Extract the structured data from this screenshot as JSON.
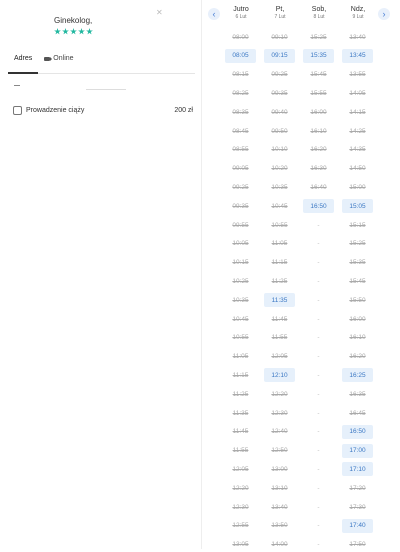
{
  "doctor": {
    "specialty": "Ginekolog,",
    "close_icon": "close-icon",
    "rating_stars": 5,
    "star_color": "#22b8a0"
  },
  "tabs": [
    {
      "label": "Adres",
      "active": true
    },
    {
      "label": "Online",
      "active": false,
      "icon": "video-icon"
    }
  ],
  "service": {
    "name": "Prowadzenie ciąży",
    "price": "200 zł",
    "icon": "clipboard-icon"
  },
  "calendar": {
    "days": [
      {
        "name": "Jutro",
        "date": "6 Lut"
      },
      {
        "name": "Pt,",
        "date": "7 Lut"
      },
      {
        "name": "Sob,",
        "date": "8 Lut"
      },
      {
        "name": "Ndz,",
        "date": "9 Lut"
      }
    ],
    "columns": [
      [
        [
          "08:00",
          "t"
        ],
        [
          "08:05",
          "f"
        ],
        [
          "08:15",
          "t"
        ],
        [
          "08:25",
          "t"
        ],
        [
          "08:35",
          "t"
        ],
        [
          "08:45",
          "t"
        ],
        [
          "08:55",
          "t"
        ],
        [
          "09:05",
          "t"
        ],
        [
          "09:25",
          "t"
        ],
        [
          "09:35",
          "t"
        ],
        [
          "09:55",
          "t"
        ],
        [
          "10:05",
          "t"
        ],
        [
          "10:15",
          "t"
        ],
        [
          "10:25",
          "t"
        ],
        [
          "10:35",
          "t"
        ],
        [
          "10:45",
          "t"
        ],
        [
          "10:55",
          "t"
        ],
        [
          "11:05",
          "t"
        ],
        [
          "11:15",
          "t"
        ],
        [
          "11:25",
          "t"
        ],
        [
          "11:35",
          "t"
        ],
        [
          "11:45",
          "t"
        ],
        [
          "11:55",
          "t"
        ],
        [
          "12:05",
          "t"
        ],
        [
          "12:20",
          "t"
        ],
        [
          "12:30",
          "t"
        ],
        [
          "12:55",
          "t"
        ],
        [
          "13:05",
          "t"
        ]
      ],
      [
        [
          "09:10",
          "t"
        ],
        [
          "09:15",
          "f"
        ],
        [
          "09:25",
          "t"
        ],
        [
          "09:35",
          "t"
        ],
        [
          "09:40",
          "t"
        ],
        [
          "09:50",
          "t"
        ],
        [
          "10:10",
          "t"
        ],
        [
          "10:20",
          "t"
        ],
        [
          "10:35",
          "t"
        ],
        [
          "10:45",
          "t"
        ],
        [
          "10:55",
          "t"
        ],
        [
          "11:05",
          "t"
        ],
        [
          "11:15",
          "t"
        ],
        [
          "11:25",
          "t"
        ],
        [
          "11:35",
          "f"
        ],
        [
          "11:45",
          "t"
        ],
        [
          "11:55",
          "t"
        ],
        [
          "12:05",
          "t"
        ],
        [
          "12:10",
          "f"
        ],
        [
          "12:20",
          "t"
        ],
        [
          "12:30",
          "t"
        ],
        [
          "12:40",
          "t"
        ],
        [
          "12:50",
          "t"
        ],
        [
          "13:00",
          "t"
        ],
        [
          "13:10",
          "t"
        ],
        [
          "13:40",
          "t"
        ],
        [
          "13:50",
          "t"
        ],
        [
          "14:00",
          "t"
        ]
      ],
      [
        [
          "15:25",
          "t"
        ],
        [
          "15:35",
          "f"
        ],
        [
          "15:45",
          "t"
        ],
        [
          "15:55",
          "t"
        ],
        [
          "16:00",
          "t"
        ],
        [
          "16:10",
          "t"
        ],
        [
          "16:20",
          "t"
        ],
        [
          "16:30",
          "t"
        ],
        [
          "16:40",
          "t"
        ],
        [
          "16:50",
          "f"
        ],
        [
          "-",
          "n"
        ],
        [
          "-",
          "n"
        ],
        [
          "-",
          "n"
        ],
        [
          "-",
          "n"
        ],
        [
          "-",
          "n"
        ],
        [
          "-",
          "n"
        ],
        [
          "-",
          "n"
        ],
        [
          "-",
          "n"
        ],
        [
          "-",
          "n"
        ],
        [
          "-",
          "n"
        ],
        [
          "-",
          "n"
        ],
        [
          "-",
          "n"
        ],
        [
          "-",
          "n"
        ],
        [
          "-",
          "n"
        ],
        [
          "-",
          "n"
        ],
        [
          "-",
          "n"
        ],
        [
          "-",
          "n"
        ],
        [
          "-",
          "n"
        ]
      ],
      [
        [
          "13:40",
          "t"
        ],
        [
          "13:45",
          "f"
        ],
        [
          "13:55",
          "t"
        ],
        [
          "14:05",
          "t"
        ],
        [
          "14:15",
          "t"
        ],
        [
          "14:25",
          "t"
        ],
        [
          "14:35",
          "t"
        ],
        [
          "14:50",
          "t"
        ],
        [
          "15:00",
          "t"
        ],
        [
          "15:05",
          "f"
        ],
        [
          "15:15",
          "t"
        ],
        [
          "15:25",
          "t"
        ],
        [
          "15:35",
          "t"
        ],
        [
          "15:45",
          "t"
        ],
        [
          "15:50",
          "t"
        ],
        [
          "16:00",
          "t"
        ],
        [
          "16:10",
          "t"
        ],
        [
          "16:20",
          "t"
        ],
        [
          "16:25",
          "f"
        ],
        [
          "16:35",
          "t"
        ],
        [
          "16:45",
          "t"
        ],
        [
          "16:50",
          "f"
        ],
        [
          "17:00",
          "f"
        ],
        [
          "17:10",
          "f"
        ],
        [
          "17:20",
          "t"
        ],
        [
          "17:30",
          "t"
        ],
        [
          "17:40",
          "f"
        ],
        [
          "17:50",
          "t"
        ]
      ]
    ]
  }
}
